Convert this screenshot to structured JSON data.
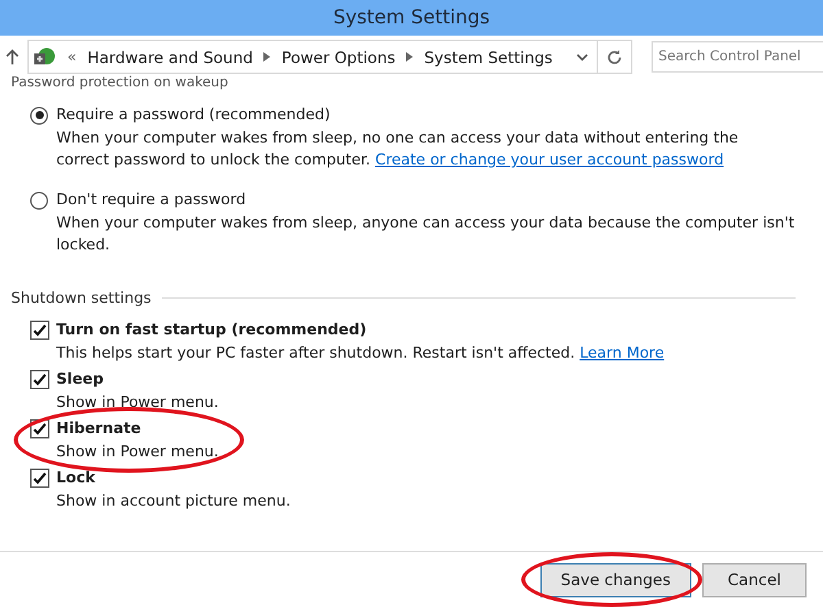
{
  "window": {
    "title": "System Settings"
  },
  "address_bar": {
    "overflow": "«",
    "path": [
      "Hardware and Sound",
      "Power Options",
      "System Settings"
    ],
    "search_placeholder": "Search Control Panel"
  },
  "password_section": {
    "heading": "Password protection on wakeup",
    "options": [
      {
        "label": "Require a password (recommended)",
        "selected": true,
        "description": "When your computer wakes from sleep, no one can access your data without entering the correct password to unlock the computer.",
        "link": "Create or change your user account password"
      },
      {
        "label": "Don't require a password",
        "selected": false,
        "description": "When your computer wakes from sleep, anyone can access your data because the computer isn't locked."
      }
    ]
  },
  "shutdown_section": {
    "heading": "Shutdown settings",
    "options": [
      {
        "label": "Turn on fast startup (recommended)",
        "checked": true,
        "highlighted": false,
        "description": "This helps start your PC faster after shutdown. Restart isn't affected.",
        "link": "Learn More"
      },
      {
        "label": "Sleep",
        "checked": true,
        "highlighted": false,
        "description": "Show in Power menu."
      },
      {
        "label": "Hibernate",
        "checked": true,
        "highlighted": true,
        "description": "Show in Power menu."
      },
      {
        "label": "Lock",
        "checked": true,
        "highlighted": false,
        "description": "Show in account picture menu."
      }
    ]
  },
  "buttons": [
    {
      "label": "Save changes",
      "highlighted": true,
      "default": true
    },
    {
      "label": "Cancel",
      "highlighted": false,
      "default": false
    }
  ]
}
